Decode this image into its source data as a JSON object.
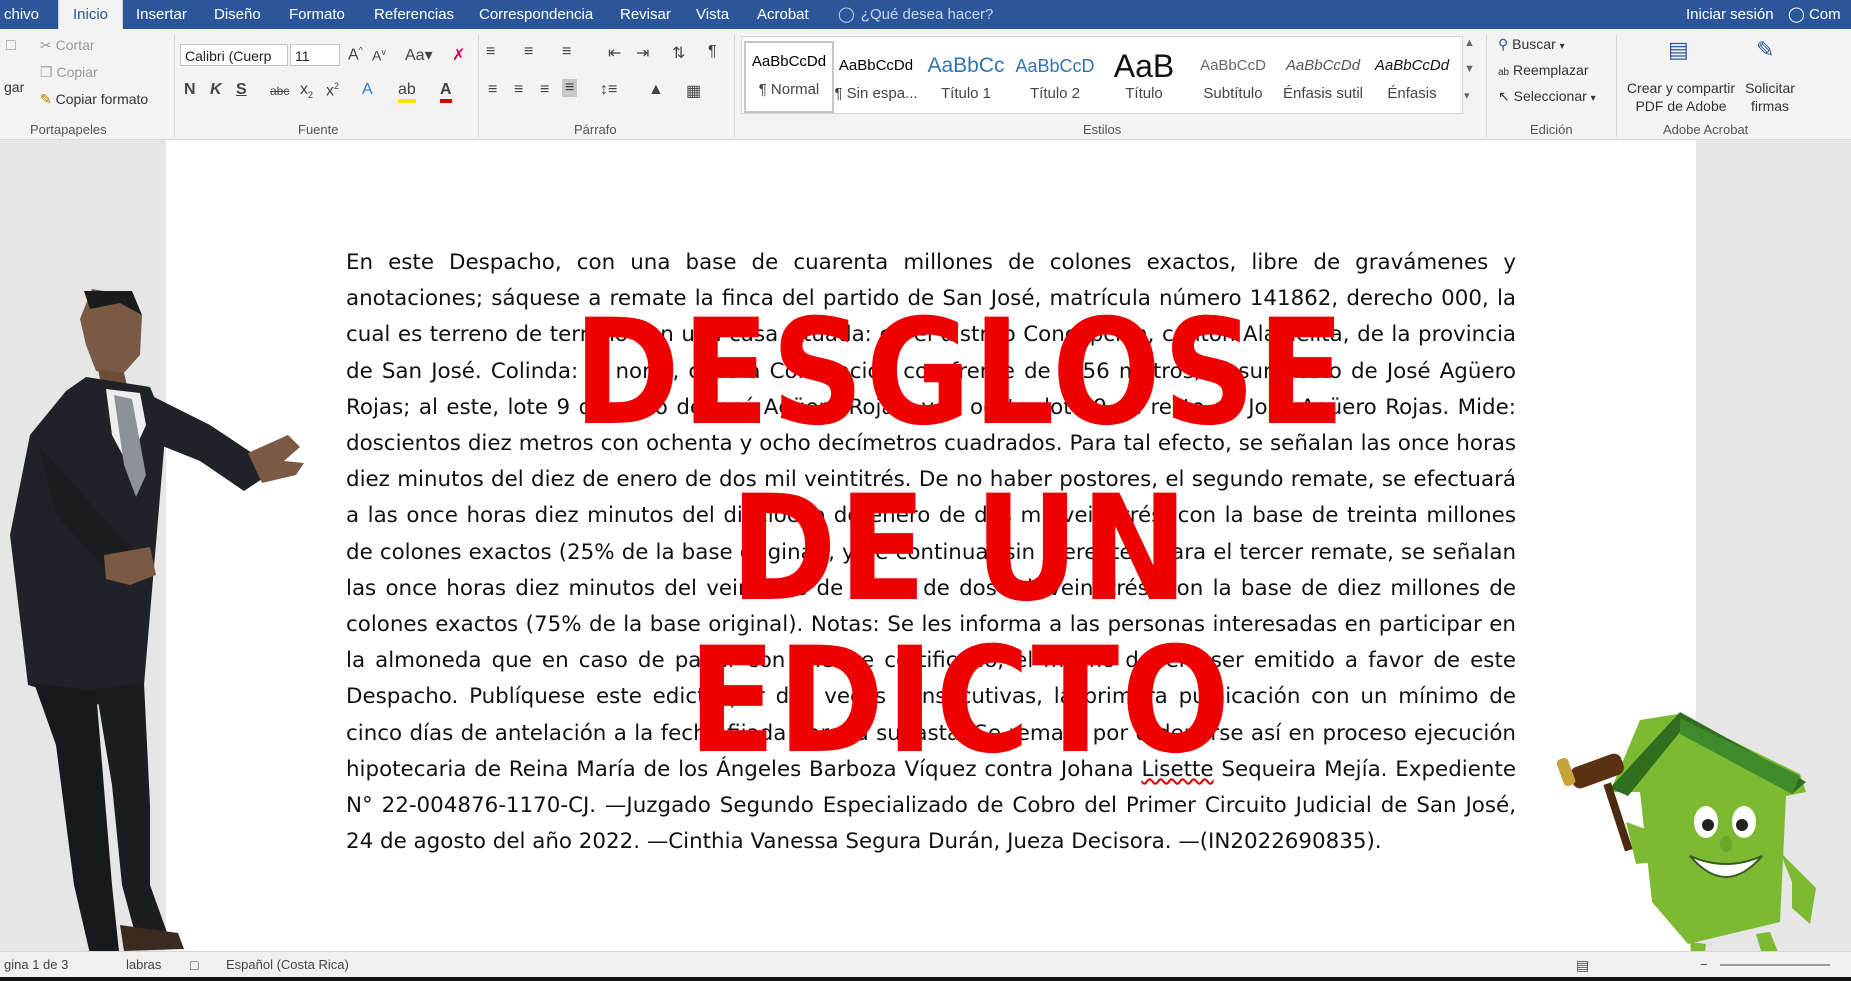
{
  "tabs": [
    "chivo",
    "Inicio",
    "Insertar",
    "Diseño",
    "Formato",
    "Referencias",
    "Correspondencia",
    "Revisar",
    "Vista",
    "Acrobat"
  ],
  "active_tab": "Inicio",
  "tell_me": "¿Qué desea hacer?",
  "signin": "Iniciar sesión",
  "share": "Com",
  "clipboard": {
    "paste": "gar",
    "cut": "Cortar",
    "copy": "Copiar",
    "format_painter": "Copiar formato",
    "label": "Portapapeles"
  },
  "font": {
    "name": "Calibri (Cuerp",
    "size": "11",
    "label": "Fuente"
  },
  "paragraph": {
    "label": "Párrafo"
  },
  "styles": {
    "label": "Estilos",
    "items": [
      {
        "preview": "AaBbCcDd",
        "name": "¶ Normal"
      },
      {
        "preview": "AaBbCcDd",
        "name": "¶ Sin espa..."
      },
      {
        "preview": "AaBbCc",
        "name": "Título 1"
      },
      {
        "preview": "AaBbCcD",
        "name": "Título 2"
      },
      {
        "preview": "AaB",
        "name": "Título"
      },
      {
        "preview": "AaBbCcD",
        "name": "Subtítulo"
      },
      {
        "preview": "AaBbCcDd",
        "name": "Énfasis sutil"
      },
      {
        "preview": "AaBbCcDd",
        "name": "Énfasis"
      }
    ]
  },
  "editing": {
    "find": "Buscar",
    "replace": "Reemplazar",
    "select": "Seleccionar",
    "label": "Edición"
  },
  "acrobat": {
    "create_line1": "Crear y compartir",
    "create_line2": "PDF de Adobe",
    "sign_line1": "Solicitar",
    "sign_line2": "firmas",
    "label": "Adobe Acrobat"
  },
  "document": {
    "text_before": "En este Despacho, con una base de cuarenta millones de colones exactos, libre de gravámenes y anotaciones; sáquese a remate la finca del partido de San José, matrícula número 141862, derecho 000, la cual es terreno de terreno con una casa situada: en el distrito Concepción, cantón Alajuelita, de la provincia de San José. Colinda: al norte, calle a Concepción con frente de 8 56 metros; al sur, resto de José Agüero Rojas; al este, lote 9 de resto de José Agüero Rojas; y al oeste, lote 9 de resto de José Agüero Rojas. Mide: doscientos diez metros con ochenta y ocho decímetros cuadrados. Para tal efecto, se señalan las once horas diez minutos del diez de enero de dos mil veintitrés. De no haber postores, el segundo remate, se efectuará a las once horas diez minutos del dieciocho de enero de dos mil veintitrés, con la base de treinta millones de colones exactos (25% de la base original), y de continuar sin oferentes, para el tercer remate, se señalan las once horas diez minutos del veintiséis de enero de dos mil veintitrés, con la base de diez millones de colones exactos (75% de la base original). Notas: Se les informa a las personas interesadas en participar en la almoneda que en caso de pagar con cheque certificado, el mismo deberá ser emitido a favor de este Despacho. Publíquese este edicto por dos veces consecutivas, la primera publicación con un mínimo de cinco días de antelación a la fecha fijada para la subasta. Se remata por ordenarse así en proceso ejecución hipotecaria de Reina María de los Ángeles Barboza Víquez contra Johana ",
    "misspelled": "Lisette",
    "text_after": " Sequeira Mejía. Expediente N° 22-004876-1170-CJ. —Juzgado Segundo Especializado de Cobro del Primer Circuito Judicial de San José, 24 de agosto del año 2022. —Cinthia Vanessa Segura Durán, Jueza Decisora. —(IN2022690835)."
  },
  "overlay": {
    "line1": "DESGLOSE",
    "line2": "DE UN",
    "line3": "EDICTO"
  },
  "status": {
    "page": "gina 1 de 3",
    "words": "labras",
    "language": "Español (Costa Rica)"
  },
  "colors": {
    "ribbon_blue": "#2b579a",
    "overlay_red": "#ee0000"
  }
}
